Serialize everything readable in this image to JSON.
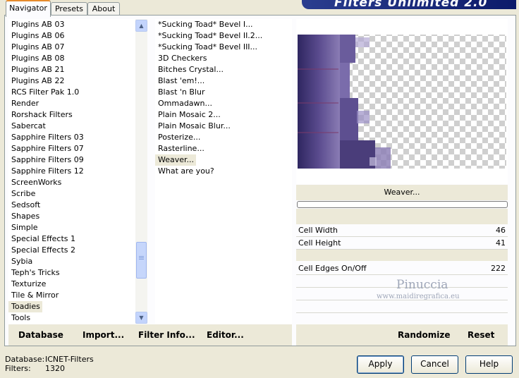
{
  "banner_title": "Filters Unlimited 2.0",
  "tabs": [
    {
      "label": "Navigator",
      "active": true
    },
    {
      "label": "Presets",
      "active": false
    },
    {
      "label": "About",
      "active": false
    }
  ],
  "categories": [
    "Plugins AB 03",
    "Plugins AB 06",
    "Plugins AB 07",
    "Plugins AB 08",
    "Plugins AB 21",
    "Plugins AB 22",
    "RCS Filter Pak 1.0",
    "Render",
    "Rorshack Filters",
    "Sabercat",
    "Sapphire Filters 03",
    "Sapphire Filters 07",
    "Sapphire Filters 09",
    "Sapphire Filters 12",
    "ScreenWorks",
    "Scribe",
    "Sedsoft",
    "Shapes",
    "Simple",
    "Special Effects 1",
    "Special Effects 2",
    "Sybia",
    "Teph's Tricks",
    "Texturize",
    "Tile & Mirror",
    "Toadies",
    "Tools"
  ],
  "selected_category": "Toadies",
  "filters": [
    "*Sucking Toad*  Bevel I...",
    "*Sucking Toad*  Bevel II.2...",
    "*Sucking Toad*  Bevel III...",
    "3D Checkers",
    "Bitches Crystal...",
    "Blast 'em!...",
    "Blast 'n Blur",
    "Ommadawn...",
    "Plain Mosaic 2...",
    "Plain Mosaic Blur...",
    "Posterize...",
    "Rasterline...",
    "Weaver...",
    "What are you?"
  ],
  "selected_filter": "Weaver...",
  "filter_name": "Weaver...",
  "progress": 0,
  "params": [
    {
      "label": "Cell Width",
      "value": "46"
    },
    {
      "label": "Cell Height",
      "value": "41"
    },
    {
      "label": "Cell Edges On/Off",
      "value": "222"
    }
  ],
  "watermark": {
    "name": "Pinuccia",
    "url": "www.maidiregrafica.eu"
  },
  "left_links": {
    "database": "Database",
    "import": "Import...",
    "filter_info": "Filter Info...",
    "editor": "Editor..."
  },
  "right_links": {
    "randomize": "Randomize",
    "reset": "Reset"
  },
  "status": {
    "database_label": "Database:",
    "database_value": "ICNET-Filters",
    "filters_label": "Filters:",
    "filters_value": "1320"
  },
  "buttons": {
    "apply": "Apply",
    "cancel": "Cancel",
    "help": "Help"
  },
  "colors": {
    "accent": "#e68b2c",
    "preview_purple": "#4a3d7a",
    "banner": "#1a2a80"
  }
}
